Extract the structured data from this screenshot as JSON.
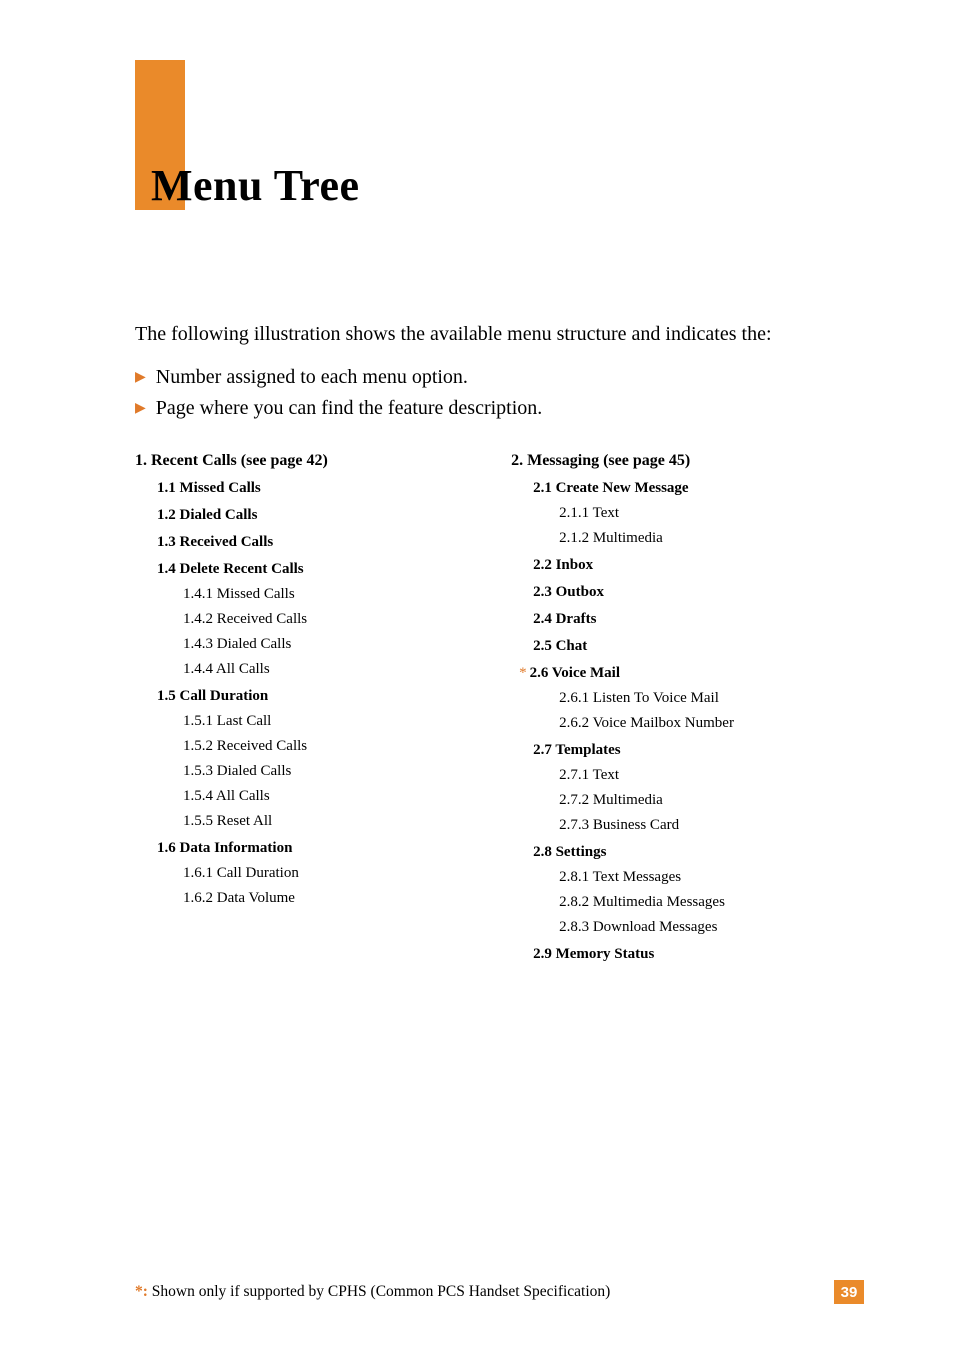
{
  "title": "Menu Tree",
  "intro": "The following illustration shows the available menu structure and indicates the:",
  "bullets": [
    "Number assigned to each menu option.",
    "Page where you can find the feature description."
  ],
  "left": {
    "head": "1. Recent Calls (see page 42)",
    "items": [
      {
        "type": "lvl1",
        "text": "1.1 Missed Calls"
      },
      {
        "type": "lvl1",
        "text": "1.2 Dialed Calls"
      },
      {
        "type": "lvl1",
        "text": "1.3 Received Calls"
      },
      {
        "type": "lvl1",
        "text": "1.4 Delete Recent Calls"
      },
      {
        "type": "lvl2",
        "text": "1.4.1 Missed Calls"
      },
      {
        "type": "lvl2",
        "text": "1.4.2 Received Calls"
      },
      {
        "type": "lvl2",
        "text": "1.4.3 Dialed Calls"
      },
      {
        "type": "lvl2",
        "text": "1.4.4 All Calls"
      },
      {
        "type": "lvl1",
        "text": "1.5 Call Duration"
      },
      {
        "type": "lvl2",
        "text": "1.5.1 Last Call"
      },
      {
        "type": "lvl2",
        "text": "1.5.2 Received Calls"
      },
      {
        "type": "lvl2",
        "text": "1.5.3 Dialed Calls"
      },
      {
        "type": "lvl2",
        "text": "1.5.4 All Calls"
      },
      {
        "type": "lvl2",
        "text": "1.5.5 Reset All"
      },
      {
        "type": "lvl1",
        "text": "1.6 Data Information"
      },
      {
        "type": "lvl2",
        "text": "1.6.1 Call Duration"
      },
      {
        "type": "lvl2",
        "text": "1.6.2 Data Volume"
      }
    ]
  },
  "right": {
    "head": "2. Messaging (see page 45)",
    "items": [
      {
        "type": "lvl1",
        "text": "2.1 Create New Message"
      },
      {
        "type": "lvl2",
        "text": "2.1.1 Text"
      },
      {
        "type": "lvl2",
        "text": "2.1.2 Multimedia"
      },
      {
        "type": "lvl1",
        "text": "2.2 Inbox"
      },
      {
        "type": "lvl1",
        "text": "2.3 Outbox"
      },
      {
        "type": "lvl1",
        "text": "2.4 Drafts"
      },
      {
        "type": "lvl1",
        "text": "2.5 Chat"
      },
      {
        "type": "lvl1",
        "text": "2.6 Voice Mail",
        "star": true
      },
      {
        "type": "lvl2",
        "text": "2.6.1 Listen To Voice Mail"
      },
      {
        "type": "lvl2",
        "text": "2.6.2 Voice Mailbox Number"
      },
      {
        "type": "lvl1",
        "text": "2.7 Templates"
      },
      {
        "type": "lvl2",
        "text": "2.7.1 Text"
      },
      {
        "type": "lvl2",
        "text": "2.7.2 Multimedia"
      },
      {
        "type": "lvl2",
        "text": "2.7.3 Business Card"
      },
      {
        "type": "lvl1",
        "text": "2.8 Settings"
      },
      {
        "type": "lvl2",
        "text": "2.8.1 Text Messages"
      },
      {
        "type": "lvl2",
        "text": "2.8.2 Multimedia Messages"
      },
      {
        "type": "lvl2",
        "text": "2.8.3 Download Messages"
      },
      {
        "type": "lvl1",
        "text": "2.9 Memory Status"
      }
    ]
  },
  "footnote_prefix": "*:",
  "footnote": " Shown only if supported by CPHS (Common PCS Handset Specification)",
  "page_number": "39"
}
